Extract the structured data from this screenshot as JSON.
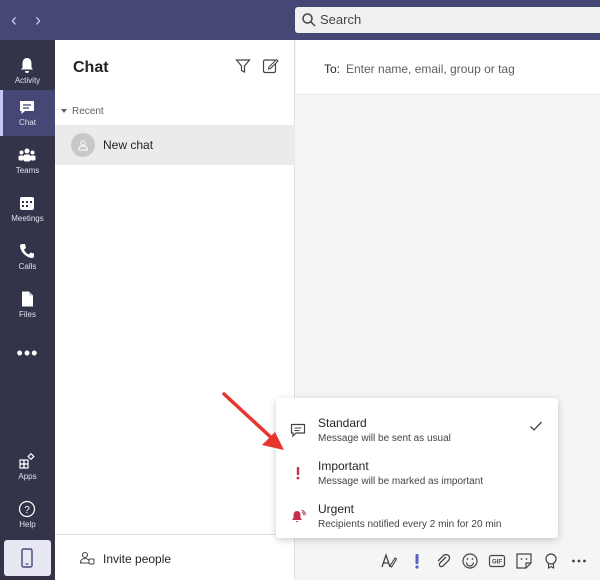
{
  "search": {
    "label": "Search"
  },
  "rail": {
    "items": [
      {
        "label": "Activity",
        "icon": "bell-icon"
      },
      {
        "label": "Chat",
        "icon": "chat-icon"
      },
      {
        "label": "Teams",
        "icon": "teams-icon"
      },
      {
        "label": "Meetings",
        "icon": "calendar-icon"
      },
      {
        "label": "Calls",
        "icon": "phone-icon"
      },
      {
        "label": "Files",
        "icon": "file-icon"
      }
    ],
    "more": "•••",
    "apps": "Apps",
    "help": "Help"
  },
  "chatlist": {
    "title": "Chat",
    "section": "Recent",
    "items": [
      {
        "label": "New chat"
      }
    ],
    "invite": "Invite people"
  },
  "main": {
    "to_label": "To:",
    "to_placeholder": "Enter name, email, group or tag"
  },
  "priority_menu": {
    "options": [
      {
        "title": "Standard",
        "description": "Message will be sent as usual",
        "selected": true
      },
      {
        "title": "Important",
        "description": "Message will be marked as important"
      },
      {
        "title": "Urgent",
        "description": "Recipients notified every 2 min for 20 min"
      }
    ]
  },
  "colors": {
    "topbar": "#464775",
    "rail": "#33344a",
    "accent": "#6264a7",
    "important": "#c4314b",
    "arrow": "#e8352e"
  }
}
